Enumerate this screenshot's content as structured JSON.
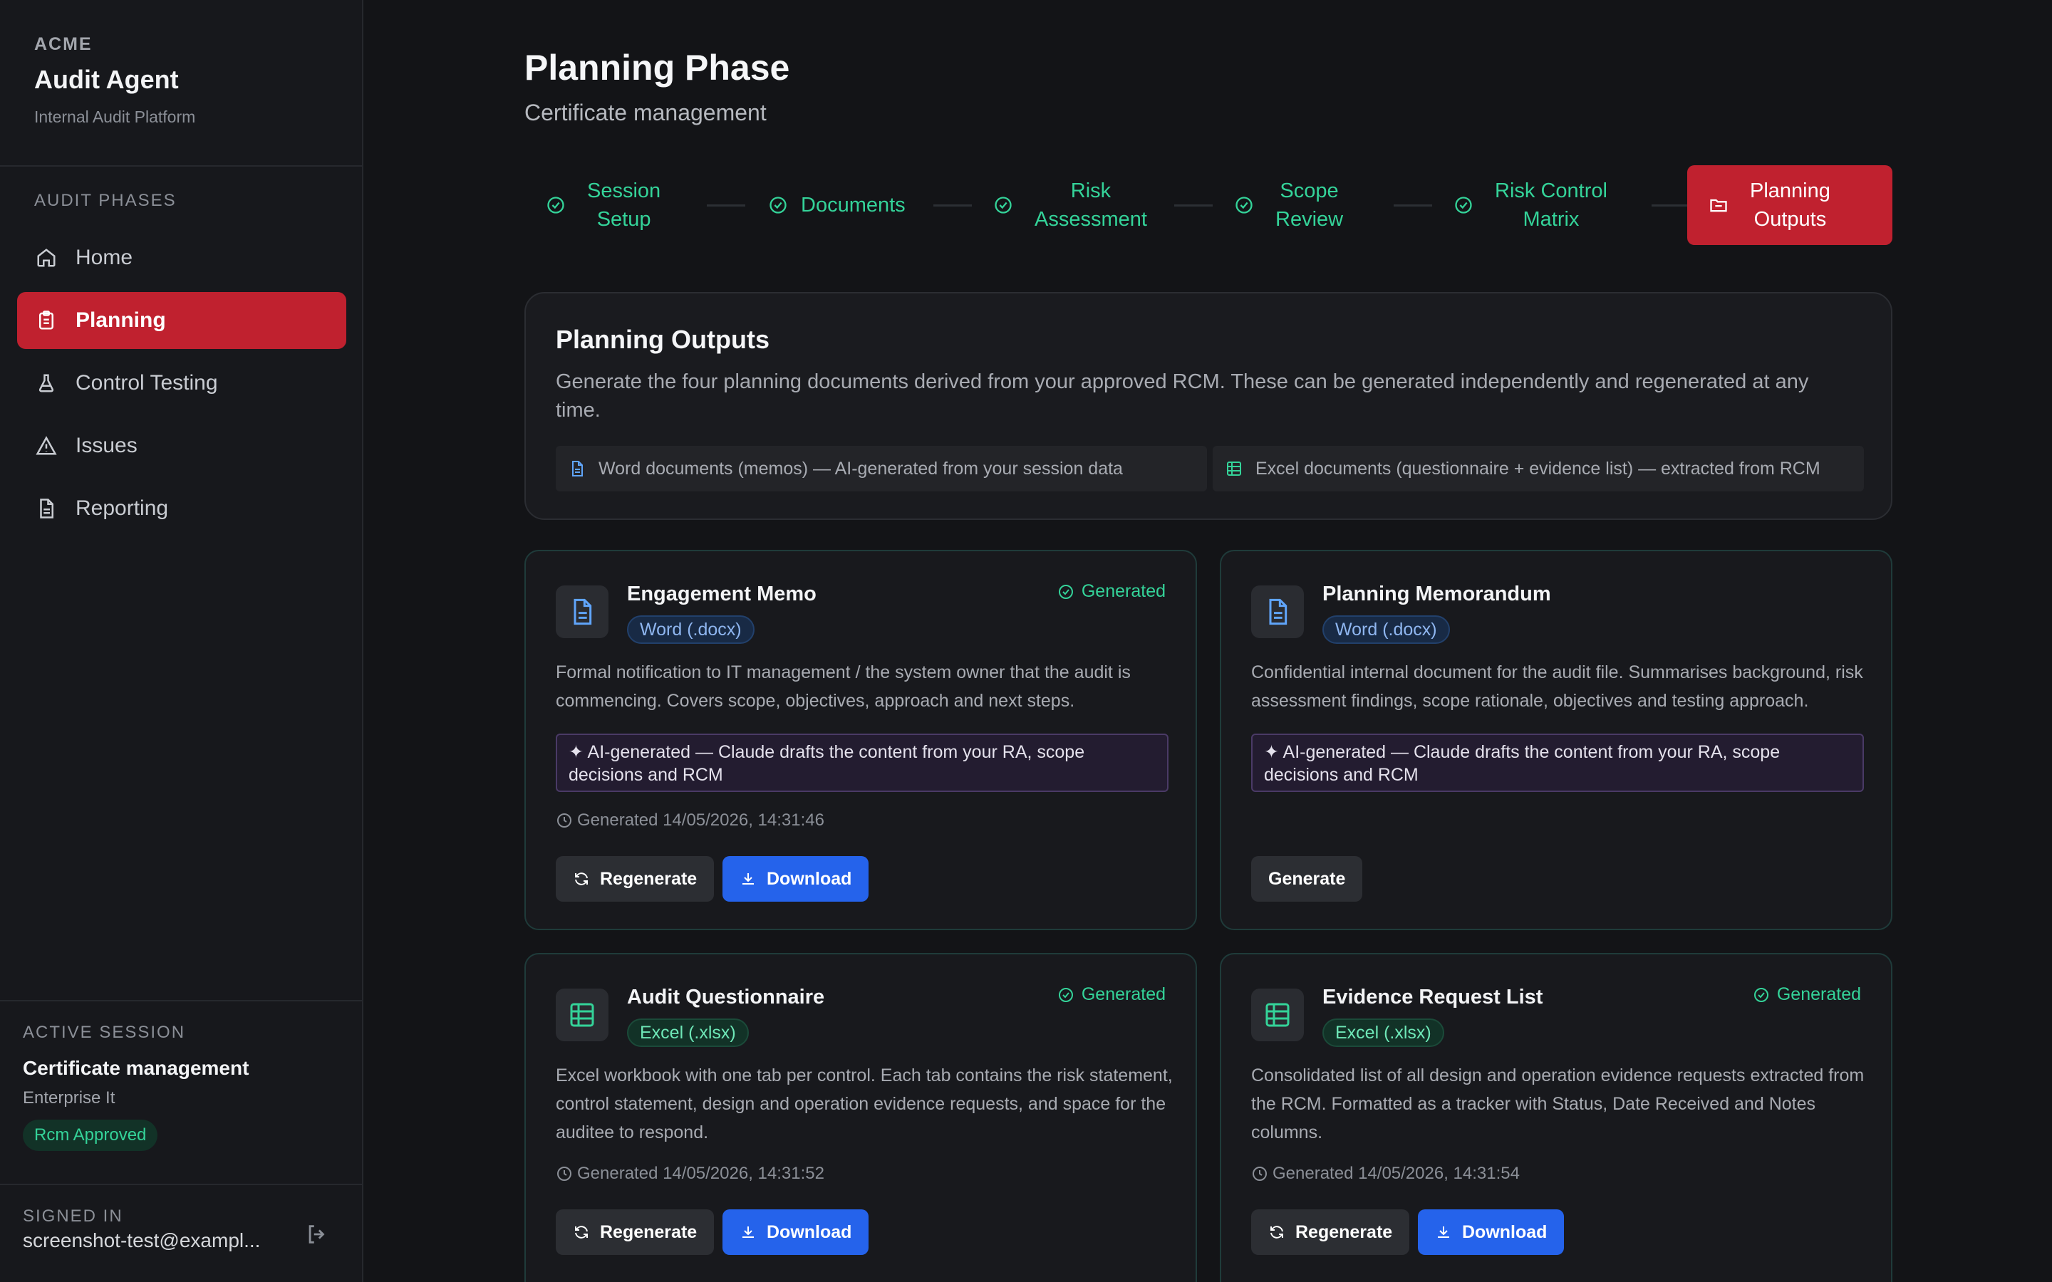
{
  "brand": {
    "org": "ACME",
    "app": "Audit Agent",
    "subtitle": "Internal Audit Platform"
  },
  "sidebar": {
    "section_label": "AUDIT PHASES",
    "items": [
      {
        "label": "Home",
        "icon": "home-icon"
      },
      {
        "label": "Planning",
        "icon": "clipboard-icon",
        "active": true
      },
      {
        "label": "Control Testing",
        "icon": "flask-icon"
      },
      {
        "label": "Issues",
        "icon": "warning-icon"
      },
      {
        "label": "Reporting",
        "icon": "document-icon"
      }
    ],
    "session": {
      "label": "ACTIVE SESSION",
      "name": "Certificate management",
      "dept": "Enterprise It",
      "status": "Rcm Approved"
    },
    "signed_in": {
      "label": "SIGNED IN",
      "email": "screenshot-test@exampl..."
    }
  },
  "header": {
    "title": "Planning Phase",
    "subtitle": "Certificate management"
  },
  "stepper": [
    {
      "label_line1": "Session",
      "label_line2": "Setup",
      "state": "done"
    },
    {
      "label_line1": "Documents",
      "label_line2": "",
      "state": "done"
    },
    {
      "label_line1": "Risk",
      "label_line2": "Assessment",
      "state": "done"
    },
    {
      "label_line1": "Scope",
      "label_line2": "Review",
      "state": "done"
    },
    {
      "label_line1": "Risk Control",
      "label_line2": "Matrix",
      "state": "done"
    },
    {
      "label_line1": "Planning",
      "label_line2": "Outputs",
      "state": "active"
    }
  ],
  "outputs_info": {
    "title": "Planning Outputs",
    "description": "Generate the four planning documents derived from your approved RCM. These can be generated independently and regenerated at any time.",
    "chip_word": "Word documents (memos) — AI-generated from your session data",
    "chip_excel": "Excel documents (questionnaire + evidence list) — extracted from RCM"
  },
  "cards": {
    "engagement_memo": {
      "title": "Engagement Memo",
      "tag": "Word (.docx)",
      "status": "Generated",
      "description": "Formal notification to IT management / the system owner that the audit is commencing. Covers scope, objectives, approach and next steps.",
      "ai_note": "✦ AI-generated — Claude drafts the content from your RA, scope decisions and RCM",
      "generated_at": "Generated 14/05/2026, 14:31:46",
      "regenerate_label": "Regenerate",
      "download_label": "Download"
    },
    "planning_memo": {
      "title": "Planning Memorandum",
      "tag": "Word (.docx)",
      "description": "Confidential internal document for the audit file. Summarises background, risk assessment findings, scope rationale, objectives and testing approach.",
      "ai_note": "✦ AI-generated — Claude drafts the content from your RA, scope decisions and RCM",
      "generate_label": "Generate"
    },
    "audit_questionnaire": {
      "title": "Audit Questionnaire",
      "tag": "Excel (.xlsx)",
      "status": "Generated",
      "description": "Excel workbook with one tab per control. Each tab contains the risk statement, control statement, design and operation evidence requests, and space for the auditee to respond.",
      "generated_at": "Generated 14/05/2026, 14:31:52",
      "regenerate_label": "Regenerate",
      "download_label": "Download"
    },
    "evidence_list": {
      "title": "Evidence Request List",
      "tag": "Excel (.xlsx)",
      "status": "Generated",
      "description": "Consolidated list of all design and operation evidence requests extracted from the RCM. Formatted as a tracker with Status, Date Received and Notes columns.",
      "generated_at": "Generated 14/05/2026, 14:31:54",
      "regenerate_label": "Regenerate",
      "download_label": "Download"
    }
  },
  "colors": {
    "accent_red": "#c0212f",
    "success_green": "#34d399",
    "primary_blue": "#2563eb"
  }
}
